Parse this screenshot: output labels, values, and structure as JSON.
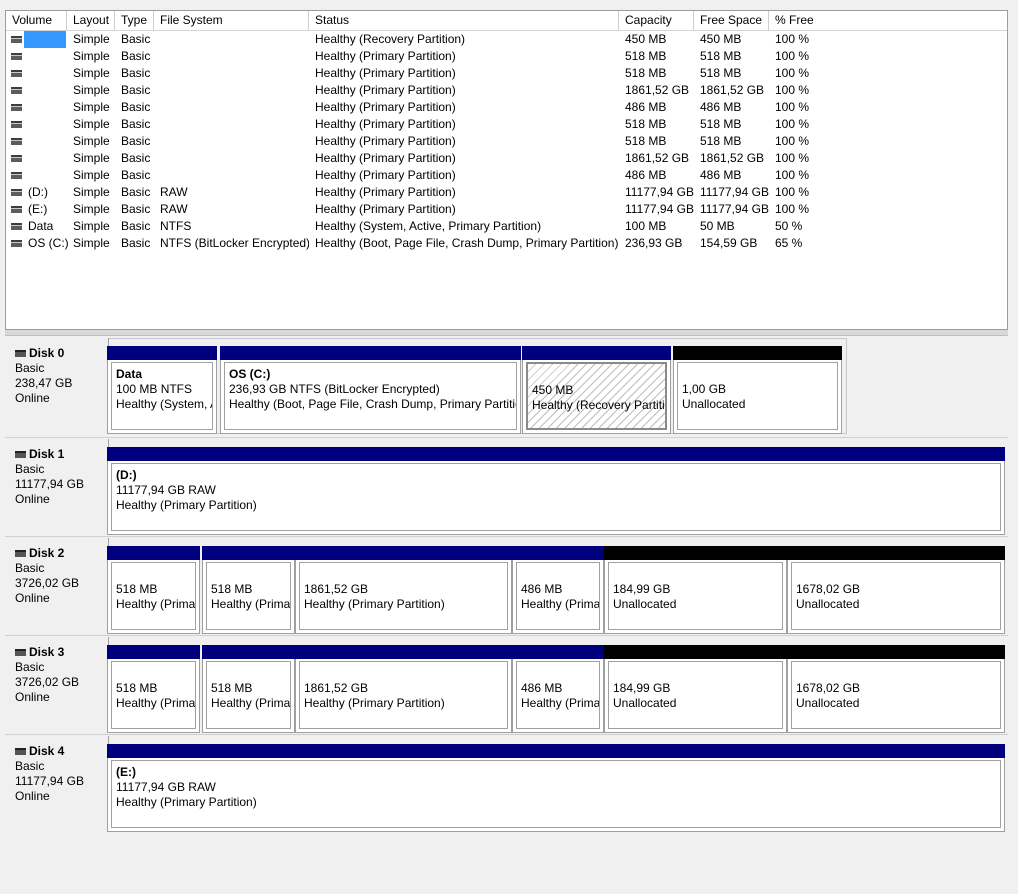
{
  "columns": [
    "Volume",
    "Layout",
    "Type",
    "File System",
    "Status",
    "Capacity",
    "Free Space",
    "% Free"
  ],
  "volumes": [
    {
      "volume": "",
      "layout": "Simple",
      "type": "Basic",
      "fs": "",
      "status": "Healthy (Recovery Partition)",
      "capacity": "450 MB",
      "free": "450 MB",
      "pct": "100 %",
      "selected": true
    },
    {
      "volume": "",
      "layout": "Simple",
      "type": "Basic",
      "fs": "",
      "status": "Healthy (Primary Partition)",
      "capacity": "518 MB",
      "free": "518 MB",
      "pct": "100 %"
    },
    {
      "volume": "",
      "layout": "Simple",
      "type": "Basic",
      "fs": "",
      "status": "Healthy (Primary Partition)",
      "capacity": "518 MB",
      "free": "518 MB",
      "pct": "100 %"
    },
    {
      "volume": "",
      "layout": "Simple",
      "type": "Basic",
      "fs": "",
      "status": "Healthy (Primary Partition)",
      "capacity": "1861,52 GB",
      "free": "1861,52 GB",
      "pct": "100 %"
    },
    {
      "volume": "",
      "layout": "Simple",
      "type": "Basic",
      "fs": "",
      "status": "Healthy (Primary Partition)",
      "capacity": "486 MB",
      "free": "486 MB",
      "pct": "100 %"
    },
    {
      "volume": "",
      "layout": "Simple",
      "type": "Basic",
      "fs": "",
      "status": "Healthy (Primary Partition)",
      "capacity": "518 MB",
      "free": "518 MB",
      "pct": "100 %"
    },
    {
      "volume": "",
      "layout": "Simple",
      "type": "Basic",
      "fs": "",
      "status": "Healthy (Primary Partition)",
      "capacity": "518 MB",
      "free": "518 MB",
      "pct": "100 %"
    },
    {
      "volume": "",
      "layout": "Simple",
      "type": "Basic",
      "fs": "",
      "status": "Healthy (Primary Partition)",
      "capacity": "1861,52 GB",
      "free": "1861,52 GB",
      "pct": "100 %"
    },
    {
      "volume": "",
      "layout": "Simple",
      "type": "Basic",
      "fs": "",
      "status": "Healthy (Primary Partition)",
      "capacity": "486 MB",
      "free": "486 MB",
      "pct": "100 %"
    },
    {
      "volume": "(D:)",
      "layout": "Simple",
      "type": "Basic",
      "fs": "RAW",
      "status": "Healthy (Primary Partition)",
      "capacity": "11177,94 GB",
      "free": "11177,94 GB",
      "pct": "100 %"
    },
    {
      "volume": "(E:)",
      "layout": "Simple",
      "type": "Basic",
      "fs": "RAW",
      "status": "Healthy (Primary Partition)",
      "capacity": "11177,94 GB",
      "free": "11177,94 GB",
      "pct": "100 %"
    },
    {
      "volume": "Data",
      "layout": "Simple",
      "type": "Basic",
      "fs": "NTFS",
      "status": "Healthy (System, Active, Primary Partition)",
      "capacity": "100 MB",
      "free": "50 MB",
      "pct": "50 %"
    },
    {
      "volume": "OS (C:)",
      "layout": "Simple",
      "type": "Basic",
      "fs": "NTFS (BitLocker Encrypted)",
      "status": "Healthy (Boot, Page File, Crash Dump, Primary Partition)",
      "capacity": "236,93 GB",
      "free": "154,59 GB",
      "pct": "65 %"
    }
  ],
  "disks": [
    {
      "name": "Disk 0",
      "type": "Basic",
      "size": "238,47 GB",
      "status": "Online",
      "partitions": [
        {
          "name": "Data",
          "size": "100 MB NTFS",
          "status": "Healthy (System, Active, Primary Partition)",
          "bar": "blue"
        },
        {
          "name": "OS  (C:)",
          "size": "236,93 GB NTFS (BitLocker Encrypted)",
          "status": "Healthy (Boot, Page File, Crash Dump, Primary Partition)",
          "bar": "blue"
        },
        {
          "name": "",
          "size": "450 MB",
          "status": "Healthy (Recovery Partition)",
          "bar": "blue",
          "hatched": true
        },
        {
          "name": "",
          "size": "1,00 GB",
          "status": "Unallocated",
          "bar": "black"
        }
      ]
    },
    {
      "name": "Disk 1",
      "type": "Basic",
      "size": "11177,94 GB",
      "status": "Online",
      "partitions": [
        {
          "name": "(D:)",
          "size": "11177,94 GB RAW",
          "status": "Healthy (Primary Partition)",
          "bar": "blue"
        }
      ]
    },
    {
      "name": "Disk 2",
      "type": "Basic",
      "size": "3726,02 GB",
      "status": "Online",
      "partitions": [
        {
          "name": "",
          "size": "518 MB",
          "status": "Healthy (Primary Partition)",
          "bar": "blue"
        },
        {
          "name": "",
          "size": "518 MB",
          "status": "Healthy (Primary Partition)",
          "bar": "blue"
        },
        {
          "name": "",
          "size": "1861,52 GB",
          "status": "Healthy (Primary Partition)",
          "bar": "blue"
        },
        {
          "name": "",
          "size": "486 MB",
          "status": "Healthy (Primary Partition)",
          "bar": "blue"
        },
        {
          "name": "",
          "size": "184,99 GB",
          "status": "Unallocated",
          "bar": "black"
        },
        {
          "name": "",
          "size": "1678,02 GB",
          "status": "Unallocated",
          "bar": "black"
        }
      ]
    },
    {
      "name": "Disk 3",
      "type": "Basic",
      "size": "3726,02 GB",
      "status": "Online",
      "partitions": [
        {
          "name": "",
          "size": "518 MB",
          "status": "Healthy (Primary Partition)",
          "bar": "blue"
        },
        {
          "name": "",
          "size": "518 MB",
          "status": "Healthy (Primary Partition)",
          "bar": "blue"
        },
        {
          "name": "",
          "size": "1861,52 GB",
          "status": "Healthy (Primary Partition)",
          "bar": "blue"
        },
        {
          "name": "",
          "size": "486 MB",
          "status": "Healthy (Primary Partition)",
          "bar": "blue"
        },
        {
          "name": "",
          "size": "184,99 GB",
          "status": "Unallocated",
          "bar": "black"
        },
        {
          "name": "",
          "size": "1678,02 GB",
          "status": "Unallocated",
          "bar": "black"
        }
      ]
    },
    {
      "name": "Disk 4",
      "type": "Basic",
      "size": "11177,94 GB",
      "status": "Online",
      "partitions": [
        {
          "name": "(E:)",
          "size": "11177,94 GB RAW",
          "status": "Healthy (Primary Partition)",
          "bar": "blue"
        }
      ]
    }
  ],
  "colors": {
    "partition_bar": "#00007f",
    "unallocated_bar": "#000000",
    "selection": "#3399ff"
  },
  "icons": {
    "volume": "disk-drive-icon",
    "disk": "disk-icon"
  }
}
